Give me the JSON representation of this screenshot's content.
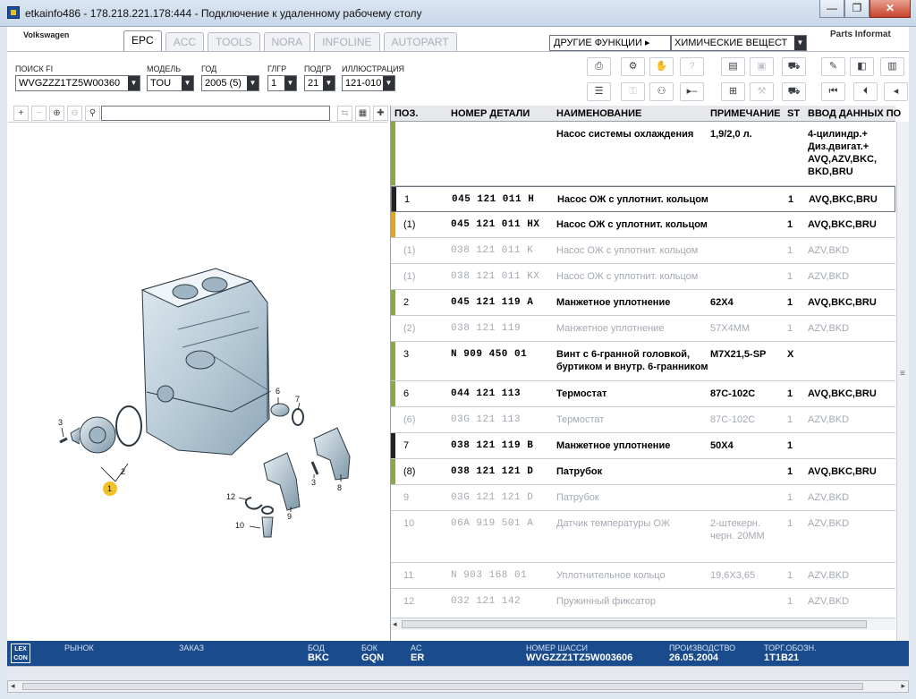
{
  "window": {
    "title": "etkainfo486 - 178.218.221.178:444 - Подключение к удаленному рабочему столу",
    "minimize": "—",
    "restore": "❐",
    "close": "✕"
  },
  "header": {
    "brand": "Volkswagen",
    "tabs": [
      "EPC",
      "ACC",
      "TOOLS",
      "NORA",
      "INFOLINE",
      "AUTOPART"
    ],
    "other_functions": "ДРУГИЕ ФУНКЦИИ ▸",
    "chem_select": "ХИМИЧЕСКИЕ ВЕЩЕСТ",
    "parts_info": "Parts Informat"
  },
  "filters": {
    "search_fi": {
      "label": "ПОИСК FI",
      "value": "WVGZZZ1TZ5W00360"
    },
    "model": {
      "label": "МОДЕЛЬ",
      "value": "TOU"
    },
    "year": {
      "label": "ГОД",
      "value": "2005 (5)"
    },
    "mgroup": {
      "label": "ГЛГР",
      "value": "1"
    },
    "subgroup": {
      "label": "ПОДГР",
      "value": "21"
    },
    "illustration": {
      "label": "ИЛЛЮСТРАЦИЯ",
      "value": "121-010"
    }
  },
  "table": {
    "headers": {
      "pos": "ПОЗ.",
      "part": "НОМЕР ДЕТАЛИ",
      "name": "НАИМЕНОВАНИЕ",
      "note": "ПРИМЕЧАНИЕ",
      "st": "ST",
      "entry": "ВВОД ДАННЫХ ПО"
    },
    "rows": [
      {
        "pos": "",
        "part": "",
        "name": "Насос системы охлаждения",
        "note": "1,9/2,0 л.",
        "st": "",
        "entry": "4-цилиндр.+ Диз.двигат.+ AVQ,AZV,BKC, BKD,BRU"
      },
      {
        "pos": "1",
        "part": "045  121  011  H",
        "name": "Насос ОЖ с уплотнит. кольцом",
        "note": "",
        "st": "1",
        "entry": "AVQ,BKC,BRU"
      },
      {
        "pos": "(1)",
        "part": "045  121  011  HX",
        "name": "Насос ОЖ с уплотнит. кольцом",
        "note": "",
        "st": "1",
        "entry": "AVQ,BKC,BRU"
      },
      {
        "pos": "(1)",
        "part": "038  121  011  K",
        "name": "Насос ОЖ с уплотнит. кольцом",
        "note": "",
        "st": "1",
        "entry": "AZV,BKD"
      },
      {
        "pos": "(1)",
        "part": "038  121  011  KX",
        "name": "Насос ОЖ с уплотнит. кольцом",
        "note": "",
        "st": "1",
        "entry": "AZV,BKD"
      },
      {
        "pos": "2",
        "part": "045  121  119  A",
        "name": "Манжетное уплотнение",
        "note": "62X4",
        "st": "1",
        "entry": "AVQ,BKC,BRU"
      },
      {
        "pos": "(2)",
        "part": "038  121  119",
        "name": "Манжетное уплотнение",
        "note": "57X4MM",
        "st": "1",
        "entry": "AZV,BKD"
      },
      {
        "pos": "3",
        "part": "N   909  450  01",
        "name": "Винт с 6-гранной головкой, буртиком и внутр. 6-гранником",
        "note": "M7X21,5-SP",
        "st": "X",
        "entry": ""
      },
      {
        "pos": "6",
        "part": "044  121  113",
        "name": "Термостат",
        "note": "87C-102C",
        "st": "1",
        "entry": "AVQ,BKC,BRU"
      },
      {
        "pos": "(6)",
        "part": "03G  121  113",
        "name": "Термостат",
        "note": "87C-102C",
        "st": "1",
        "entry": "AZV,BKD"
      },
      {
        "pos": "7",
        "part": "038  121  119  B",
        "name": "Манжетное уплотнение",
        "note": "50X4",
        "st": "1",
        "entry": ""
      },
      {
        "pos": "(8)",
        "part": "038  121  121  D",
        "name": "Патрубок",
        "note": "",
        "st": "1",
        "entry": "AVQ,BKC,BRU"
      },
      {
        "pos": "9",
        "part": "03G  121  121  D",
        "name": "Патрубок",
        "note": "",
        "st": "1",
        "entry": "AZV,BKD"
      },
      {
        "pos": "10",
        "part": "06A  919  501  A",
        "name": "Датчик температуры ОЖ",
        "note": "2-штекерн. черн. 20MM",
        "st": "1",
        "entry": "AZV,BKD"
      },
      {
        "pos": "11",
        "part": "N   903  168  01",
        "name": "Уплотнительное кольцо",
        "note": "19,6X3,65",
        "st": "1",
        "entry": "AZV,BKD"
      },
      {
        "pos": "12",
        "part": "032  121  142",
        "name": "Пружинный фиксатор",
        "note": "",
        "st": "1",
        "entry": "AZV,BKD"
      }
    ]
  },
  "illustration": {
    "callouts": [
      "1",
      "2",
      "3",
      "6",
      "7",
      "3",
      "8",
      "9",
      "10",
      "12"
    ]
  },
  "status": {
    "logo": "LEX CON",
    "market_label": "РЫНОК",
    "order_label": "ЗАКАЗ",
    "bod_label": "БОД",
    "bod_value": "BKC",
    "bok_label": "БОК",
    "bok_value": "GQN",
    "ac_label": "AC",
    "ac_value": "ER",
    "chassis_label": "НОМЕР ШАССИ",
    "chassis_value": "WVGZZZ1TZ5W003606",
    "prod_label": "ПРОИЗВОДСТВО",
    "prod_value": "26.05.2004",
    "trade_label": "ТОРГ.ОБОЗН.",
    "trade_value": "1T1B21"
  },
  "colors": {
    "accent_green": "#8aa84a",
    "accent_orange": "#e0a528",
    "status_blue": "#1a4b8c"
  }
}
